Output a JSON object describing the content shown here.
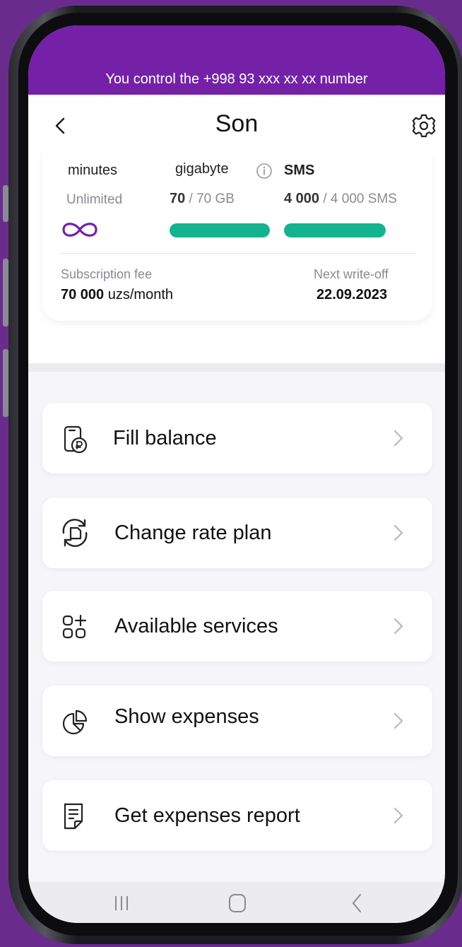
{
  "status_banner": "You control the +998 93 xxx xx xx number",
  "header": {
    "title": "Son",
    "back_icon": "chevron-left-icon",
    "settings_icon": "gear-icon"
  },
  "usage": {
    "minutes": {
      "label": "minutes",
      "value": "Unlimited",
      "icon": "infinity-icon"
    },
    "data": {
      "label": "gigabyte",
      "remaining": "70",
      "total": "/ 70 GB",
      "progress": 1.0,
      "info_icon": "info-icon"
    },
    "sms": {
      "label": "SMS",
      "remaining": "4 000",
      "total": "/ 4 000 SMS",
      "progress": 1.0
    }
  },
  "fee": {
    "label": "Subscription fee",
    "amount": "70 000",
    "unit": "uzs/month"
  },
  "write_off": {
    "label": "Next write-off",
    "date": "22.09.2023"
  },
  "menu": [
    {
      "label": "Fill balance",
      "icon": "wallet-ruble-icon"
    },
    {
      "label": "Change rate plan",
      "icon": "rotate-sim-icon"
    },
    {
      "label": "Available services",
      "icon": "grid-plus-icon"
    },
    {
      "label": "Show expenses",
      "icon": "pie-chart-icon"
    },
    {
      "label": "Get expenses report",
      "icon": "report-document-icon"
    }
  ],
  "colors": {
    "brand_purple": "#7421a8",
    "progress_green": "#13b38e",
    "background_purple": "#6a2c8c",
    "accent_teal": "#19a98a"
  },
  "nav_icons": [
    "recent-apps-icon",
    "home-icon",
    "back-icon"
  ]
}
